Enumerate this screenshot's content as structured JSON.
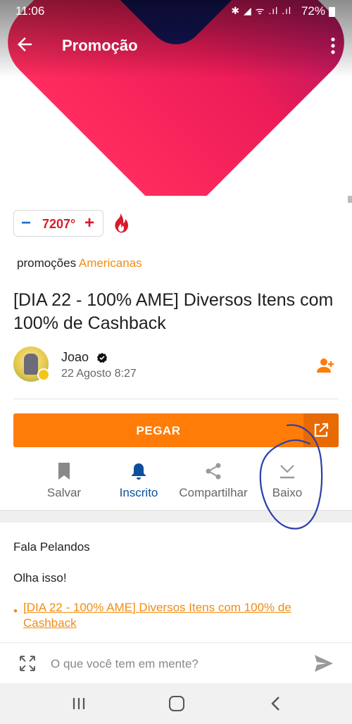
{
  "status_bar": {
    "time": "11:06",
    "icons": "✱ ◢ ᯤ .ıl .ıl",
    "battery": "72%"
  },
  "app_bar": {
    "title": "Promoção",
    "back_icon": "arrow-left-icon",
    "menu_icon": "more-vert-icon"
  },
  "votes": {
    "minus": "−",
    "count": "7207°",
    "plus": "+",
    "hot_icon": "fire-icon"
  },
  "category": {
    "prefix": "promoções",
    "store": "Americanas"
  },
  "deal": {
    "title": "[DIA 22 - 100% AME] Diversos Itens com 100% de Cashback"
  },
  "author": {
    "name": "Joao",
    "date": "22 Agosto 8:27"
  },
  "get_button": {
    "label": "PEGAR"
  },
  "actions": [
    {
      "label": "Salvar",
      "icon": "bookmark-icon"
    },
    {
      "label": "Inscrito",
      "icon": "bell-icon"
    },
    {
      "label": "Compartilhar",
      "icon": "share-icon"
    },
    {
      "label": "Baixo",
      "icon": "chevron-down-icon"
    }
  ],
  "content": {
    "greeting": "Fala Pelandos",
    "line2": "Olha isso!",
    "bullet": "•",
    "link": "[DIA 22 - 100% AME] Diversos Itens com 100% de Cashback"
  },
  "comment": {
    "placeholder": "O que você tem em mente?"
  },
  "colors": {
    "accent": "#ff7c09",
    "store": "#f28c12",
    "hot": "#d81b2a",
    "link_blue": "#0d4f9c"
  }
}
